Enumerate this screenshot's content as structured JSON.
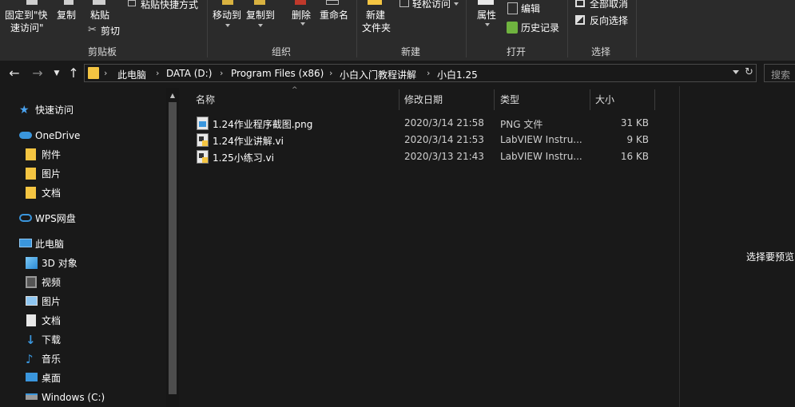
{
  "ribbon": {
    "clipboard": {
      "pin_label_line1": "固定到\"快",
      "pin_label_line2": "速访问\"",
      "copy_label": "复制",
      "paste_label": "粘贴",
      "paste_shortcut_label": "粘贴快捷方式",
      "cut_label": "剪切",
      "group_label": "剪贴板"
    },
    "organize": {
      "move_label": "移动到",
      "copy_to_label": "复制到",
      "delete_label": "删除",
      "rename_label": "重命名",
      "group_label": "组织"
    },
    "new": {
      "new_folder_line1": "新建",
      "new_folder_line2": "文件夹",
      "easy_access_label": "轻松访问",
      "group_label": "新建"
    },
    "open": {
      "properties_label": "属性",
      "edit_label": "编辑",
      "history_label": "历史记录",
      "group_label": "打开"
    },
    "select": {
      "select_none_label": "全部取消",
      "invert_label": "反向选择",
      "group_label": "选择"
    }
  },
  "address": {
    "crumbs": [
      "此电脑",
      "DATA (D:)",
      "Program Files (x86)",
      "小白入门教程讲解",
      "小白1.25"
    ],
    "search_placeholder": "搜索"
  },
  "nav": {
    "items": [
      {
        "label": "快速访问",
        "icon": "star-icon"
      },
      {
        "label": "OneDrive",
        "icon": "cloud-icon"
      },
      {
        "label": "附件",
        "icon": "folder-icon"
      },
      {
        "label": "图片",
        "icon": "folder-icon"
      },
      {
        "label": "文档",
        "icon": "folder-icon"
      },
      {
        "label": "WPS网盘",
        "icon": "wps-cloud-icon"
      },
      {
        "label": "此电脑",
        "icon": "computer-icon"
      },
      {
        "label": "3D 对象",
        "icon": "cube-icon"
      },
      {
        "label": "视频",
        "icon": "video-icon"
      },
      {
        "label": "图片",
        "icon": "pictures-icon"
      },
      {
        "label": "文档",
        "icon": "documents-icon"
      },
      {
        "label": "下载",
        "icon": "download-icon"
      },
      {
        "label": "音乐",
        "icon": "music-icon"
      },
      {
        "label": "桌面",
        "icon": "desktop-icon"
      },
      {
        "label": "Windows (C:)",
        "icon": "drive-icon"
      }
    ]
  },
  "columns": {
    "name": "名称",
    "date": "修改日期",
    "type": "类型",
    "size": "大小"
  },
  "files": [
    {
      "name": "1.24作业程序截图.png",
      "date": "2020/3/14 21:58",
      "type": "PNG 文件",
      "size": "31 KB",
      "icon": "png-file-icon"
    },
    {
      "name": "1.24作业讲解.vi",
      "date": "2020/3/14 21:53",
      "type": "LabVIEW Instru...",
      "size": "9 KB",
      "icon": "labview-file-icon"
    },
    {
      "name": "1.25小练习.vi",
      "date": "2020/3/13 21:43",
      "type": "LabVIEW Instru...",
      "size": "16 KB",
      "icon": "labview-file-icon"
    }
  ],
  "preview": {
    "message": "选择要预览"
  },
  "colors": {
    "background": "#191919",
    "ribbon": "#2b2b2b",
    "folder": "#f4c542",
    "accent": "#3a96dd"
  }
}
